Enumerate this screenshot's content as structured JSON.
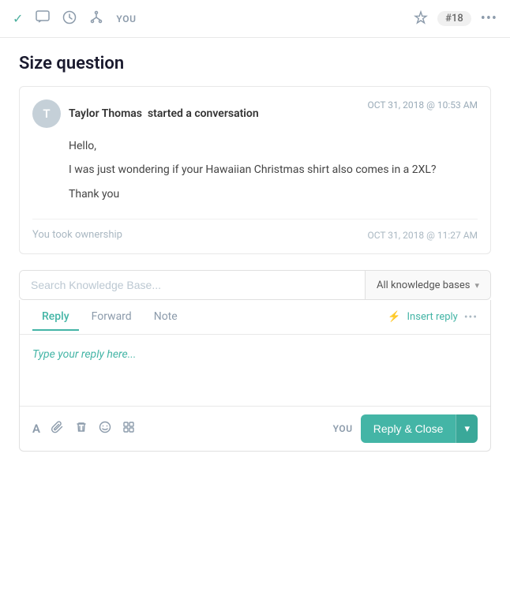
{
  "toolbar": {
    "label": "YOU",
    "badge": "#18",
    "icons": {
      "check": "✓",
      "chat": "⬜",
      "clock": "○",
      "fork": "⑂",
      "star": "☆",
      "more": "•••"
    }
  },
  "page": {
    "title": "Size question"
  },
  "conversation": {
    "sender": {
      "initial": "T",
      "name": "Taylor Thomas",
      "action": "started a conversation",
      "timestamp": "OCT 31, 2018 @ 10:53 AM"
    },
    "messages": [
      {
        "text": "Hello,"
      },
      {
        "text": "I was just wondering if your Hawaiian Christmas shirt also comes in a 2XL?"
      },
      {
        "text": "Thank you"
      }
    ],
    "ownership": {
      "text": "You took ownership",
      "timestamp": "OCT 31, 2018 @ 11:27 AM"
    }
  },
  "kb_search": {
    "placeholder": "Search Knowledge Base...",
    "dropdown_label": "All knowledge bases"
  },
  "reply_area": {
    "tabs": [
      {
        "label": "Reply",
        "active": true
      },
      {
        "label": "Forward",
        "active": false
      },
      {
        "label": "Note",
        "active": false
      }
    ],
    "insert_reply": "Insert reply",
    "placeholder": "Type your reply here...",
    "you_label": "YOU",
    "reply_close_label": "Reply & Close",
    "footer_icons": {
      "text": "A",
      "attach": "📎",
      "trash": "🗑",
      "emoji": "🙂",
      "grid": "▦"
    }
  }
}
